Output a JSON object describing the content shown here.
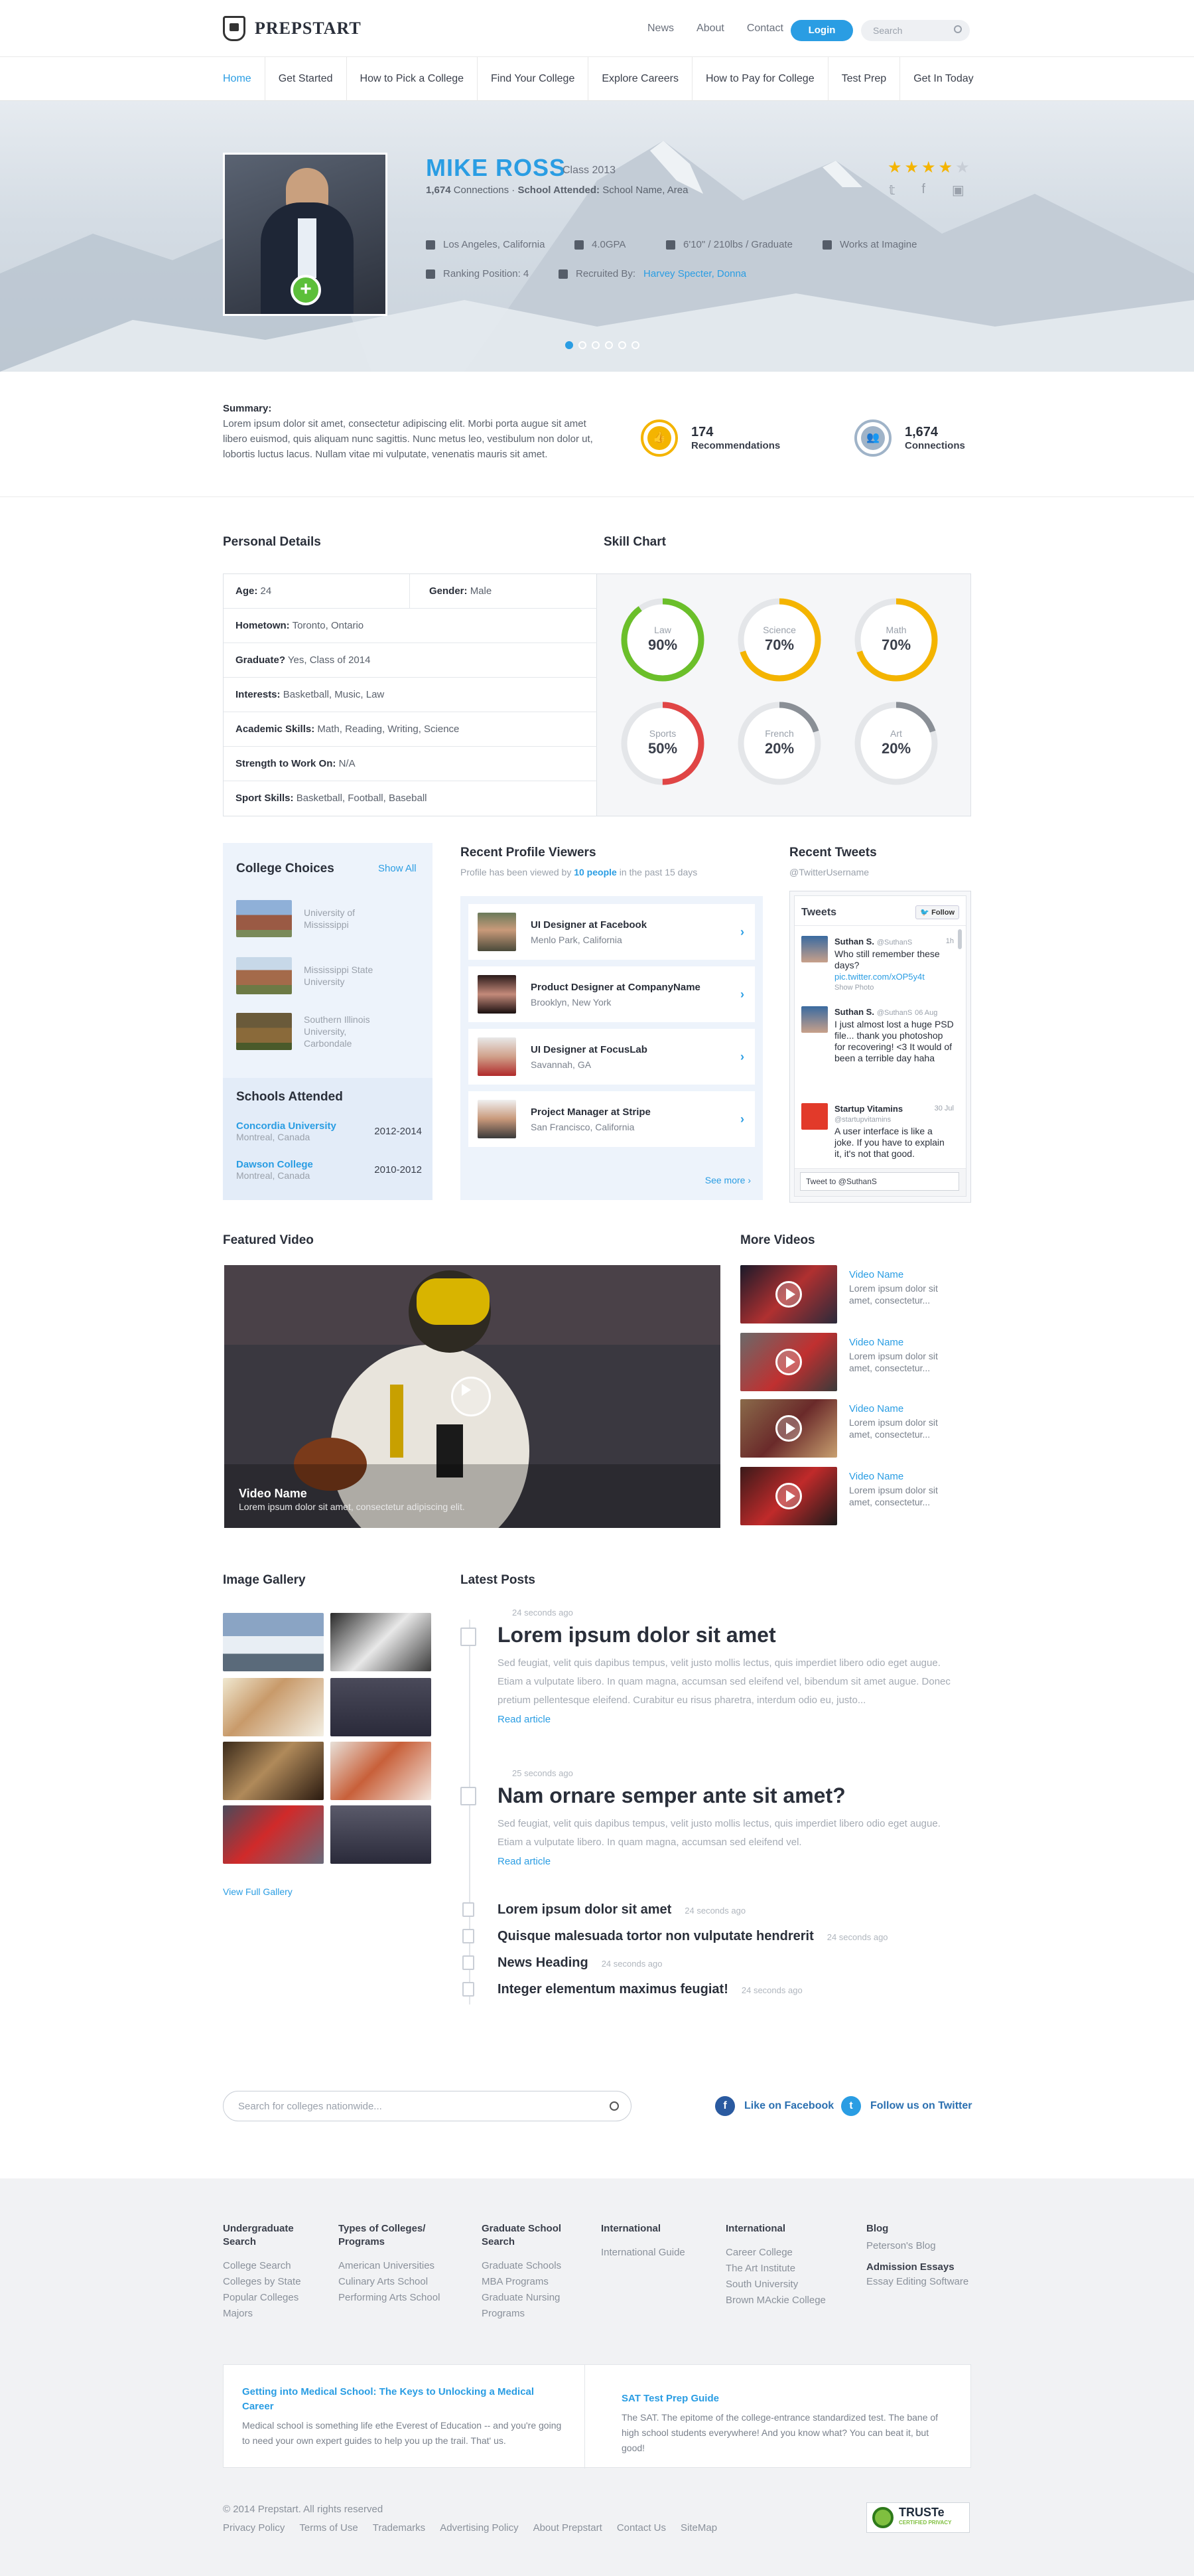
{
  "brand": {
    "name": "PREPSTART"
  },
  "topnav": {
    "items": [
      "News",
      "About",
      "Contact"
    ],
    "login": "Login",
    "search_placeholder": "Search"
  },
  "mainnav": [
    "Home",
    "Get Started",
    "How to Pick a College",
    "Find Your College",
    "Explore Careers",
    "How to Pay for College",
    "Test Prep",
    "Get In Today"
  ],
  "profile": {
    "name": "MIKE ROSS",
    "class": "Class 2013",
    "connections_count": "1,674",
    "connections_text": "Connections",
    "school_label": "School Attended:",
    "school_value": "School Name, Area",
    "location": "Los Angeles, California",
    "gpa": "4.0GPA",
    "body": "6'10\" / 210lbs / Graduate",
    "works": "Works at Imagine",
    "ranking": "Ranking Position: 4",
    "recruited_label": "Recruited By:",
    "recruited_by": "Harvey Specter, Donna",
    "rating": 4,
    "rating_max": 5,
    "slides": 6,
    "active_slide": 1
  },
  "summary": {
    "label": "Summary:",
    "text": "Lorem ipsum dolor sit amet, consectetur adipiscing elit. Morbi porta augue sit amet libero euismod, quis aliquam nunc sagittis. Nunc metus leo, vestibulum non dolor ut, lobortis luctus lacus. Nullam vitae mi vulputate, venenatis mauris sit amet."
  },
  "stats": [
    {
      "num": "174",
      "label": "Recommendations"
    },
    {
      "num": "1,674",
      "label": "Connections"
    }
  ],
  "personal_details": {
    "title": "Personal Details",
    "age_label": "Age:",
    "age": "24",
    "gender_label": "Gender:",
    "gender": "Male",
    "rows": [
      {
        "label": "Hometown:",
        "value": "Toronto, Ontario"
      },
      {
        "label": "Graduate?",
        "value": "Yes, Class of 2014"
      },
      {
        "label": "Interests:",
        "value": "Basketball, Music, Law"
      },
      {
        "label": "Academic Skills:",
        "value": "Math, Reading, Writing, Science"
      },
      {
        "label": "Strength to Work On:",
        "value": "N/A"
      },
      {
        "label": "Sport Skills:",
        "value": "Basketball, Football, Baseball"
      }
    ]
  },
  "skill_chart": {
    "title": "Skill Chart",
    "skills": [
      {
        "name": "Law",
        "pct": 90,
        "label": "90%",
        "color": "#6bbf2a"
      },
      {
        "name": "Science",
        "pct": 70,
        "label": "70%",
        "color": "#f4b400"
      },
      {
        "name": "Math",
        "pct": 70,
        "label": "70%",
        "color": "#f4b400"
      },
      {
        "name": "Sports",
        "pct": 50,
        "label": "50%",
        "color": "#e04545"
      },
      {
        "name": "French",
        "pct": 20,
        "label": "20%",
        "color": "#8a8f96"
      },
      {
        "name": "Art",
        "pct": 20,
        "label": "20%",
        "color": "#8a8f96"
      }
    ]
  },
  "college_choices": {
    "title": "College Choices",
    "show_all": "Show All",
    "items": [
      "University of Mississippi",
      "Mississippi State University",
      "Southern Illinois University, Carbondale"
    ]
  },
  "schools_attended": {
    "title": "Schools Attended",
    "items": [
      {
        "name": "Concordia University",
        "place": "Montreal, Canada",
        "years": "2012-2014"
      },
      {
        "name": "Dawson College",
        "place": "Montreal, Canada",
        "years": "2010-2012"
      }
    ]
  },
  "viewers": {
    "title": "Recent Profile Viewers",
    "sub_pre": "Profile has been viewed by",
    "sub_count": "10 people",
    "sub_post": "in the past 15 days",
    "items": [
      {
        "title": "UI Designer at Facebook",
        "place": "Menlo Park, California"
      },
      {
        "title": "Product Designer at CompanyName",
        "place": "Brooklyn, New York"
      },
      {
        "title": "UI Designer at FocusLab",
        "place": "Savannah, GA"
      },
      {
        "title": "Project Manager at Stripe",
        "place": "San Francisco, California"
      }
    ],
    "see_more": "See more"
  },
  "tweets": {
    "title": "Recent Tweets",
    "handle": "@TwitterUsername",
    "widget_title": "Tweets",
    "follow": "Follow",
    "items": [
      {
        "name": "Suthan S.",
        "handle": "@SuthanS",
        "time": "1h",
        "text": "Who still remember these days?",
        "link": "pic.twitter.com/xOP5y4t",
        "extra": "Show Photo"
      },
      {
        "name": "Suthan S.",
        "handle": "@SuthanS",
        "time": "06 Aug",
        "text": "I just almost lost a huge PSD file... thank you photoshop for recovering! <3 It would of been a terrible day haha"
      },
      {
        "name": "Startup Vitamins",
        "handle": "@startupvitamins",
        "time": "30 Jul",
        "text": "A user interface is like a joke. If you have to explain it, it's not that good."
      }
    ],
    "compose": "Tweet to @SuthanS"
  },
  "featured_video": {
    "title": "Featured Video",
    "name": "Video Name",
    "desc": "Lorem ipsum dolor sit amet, consectetur adipiscing elit."
  },
  "more_videos": {
    "title": "More Videos",
    "items": [
      {
        "name": "Video Name",
        "desc": "Lorem ipsum dolor sit amet, consectetur..."
      },
      {
        "name": "Video Name",
        "desc": "Lorem ipsum dolor sit amet, consectetur..."
      },
      {
        "name": "Video Name",
        "desc": "Lorem ipsum dolor sit amet, consectetur..."
      },
      {
        "name": "Video Name",
        "desc": "Lorem ipsum dolor sit amet, consectetur..."
      }
    ]
  },
  "gallery": {
    "title": "Image Gallery",
    "view_full": "View Full Gallery"
  },
  "posts": {
    "title": "Latest Posts",
    "big": [
      {
        "time": "24 seconds ago",
        "title": "Lorem ipsum dolor sit amet",
        "excerpt": "Sed feugiat, velit quis dapibus tempus, velit justo mollis lectus, quis imperdiet libero odio eget augue. Etiam a vulputate libero. In quam magna, accumsan sed eleifend vel, bibendum sit amet augue. Donec pretium pellentesque eleifend. Curabitur eu risus pharetra, interdum odio eu, justo...",
        "read": "Read article"
      },
      {
        "time": "25 seconds ago",
        "title": "Nam ornare semper ante sit amet?",
        "excerpt": "Sed feugiat, velit quis dapibus tempus, velit justo mollis lectus, quis imperdiet libero odio eget augue. Etiam a vulputate libero. In quam magna, accumsan sed eleifend vel.",
        "read": "Read article"
      }
    ],
    "small": [
      {
        "title": "Lorem ipsum dolor sit amet",
        "time": "24 seconds ago"
      },
      {
        "title": "Quisque malesuada tortor non vulputate hendrerit",
        "time": "24 seconds ago"
      },
      {
        "title": "News Heading",
        "time": "24 seconds ago"
      },
      {
        "title": "Integer elementum maximus feugiat!",
        "time": "24 seconds ago"
      }
    ]
  },
  "bottom": {
    "search_placeholder": "Search for colleges nationwide...",
    "facebook": "Like on Facebook",
    "twitter": "Follow us on Twitter"
  },
  "footer": {
    "cols": [
      {
        "title": "Undergraduate Search",
        "links": [
          "College Search",
          "Colleges by State",
          "Popular Colleges",
          "Majors"
        ]
      },
      {
        "title": "Types of Colleges/ Programs",
        "links": [
          "American Universities",
          "Culinary Arts School",
          "Performing Arts School"
        ]
      },
      {
        "title": "Graduate School Search",
        "links": [
          "Graduate Schools",
          "MBA Programs",
          "Graduate Nursing Programs"
        ]
      },
      {
        "title": "International",
        "links": [
          "International Guide"
        ]
      },
      {
        "title": "International",
        "links": [
          "Career College",
          "The Art Institute",
          "South University",
          "Brown MAckie College"
        ]
      },
      {
        "title": "Blog",
        "links": [
          "Peterson's Blog"
        ],
        "title2": "Admission Essays",
        "links2": [
          "Essay Editing Software"
        ]
      }
    ],
    "articles": [
      {
        "title": "Getting into Medical School: The Keys to Unlocking a Medical Career",
        "text": "Medical school is something life ethe Everest of Education -- and you're going to need your own expert guides to help you up the trail. That' us."
      },
      {
        "title": "SAT Test Prep Guide",
        "text": "The SAT. The epitome of the college-entrance standardized test. The bane of high school students everywhere! And you know what? You can beat it, but good!"
      }
    ],
    "copyright": "© 2014 Prepstart. All rights reserved",
    "links": [
      "Privacy Policy",
      "Terms of Use",
      "Trademarks",
      "Advertising Policy",
      "About Prepstart",
      "Contact Us",
      "SiteMap"
    ],
    "badge": "TRUSTe",
    "badge_sub": "CERTIFIED PRIVACY"
  }
}
